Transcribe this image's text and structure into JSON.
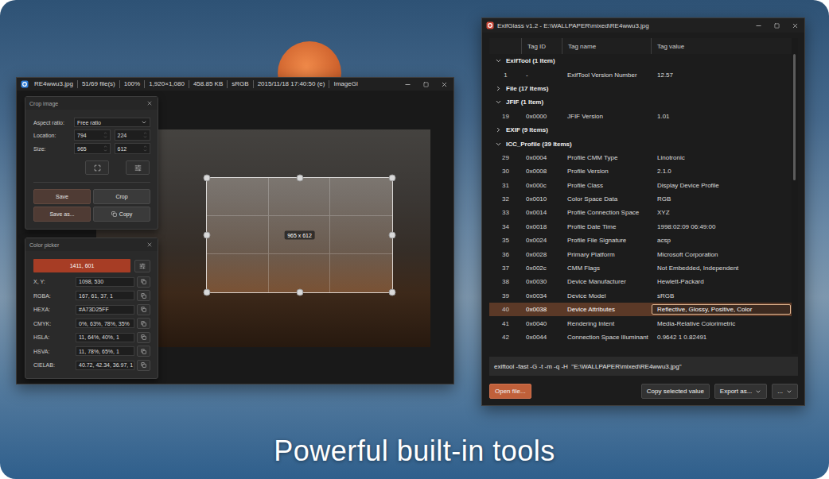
{
  "caption": "Powerful built-in tools",
  "viewer": {
    "title_fields": [
      "RE4wwu3.jpg",
      "51/69 file(s)",
      "100%",
      "1,920×1,080",
      "458.85 KB",
      "sRGB",
      "2015/11/18 17:40:50 (e)",
      "ImageGl"
    ],
    "crop_label": "965 x 612",
    "crop_panel": {
      "title": "Crop image",
      "aspect": {
        "label": "Aspect ratio:",
        "value": "Free ratio"
      },
      "location": {
        "label": "Location:",
        "values": [
          "794",
          "224"
        ]
      },
      "size": {
        "label": "Size:",
        "values": [
          "965",
          "612"
        ]
      },
      "buttons": [
        {
          "label": "Save",
          "accent": true,
          "with_icon": false
        },
        {
          "label": "Crop",
          "accent": false,
          "with_icon": false
        },
        {
          "label": "Save as...",
          "accent": true,
          "with_icon": false
        },
        {
          "label": "Copy",
          "accent": false,
          "with_icon": true
        }
      ]
    },
    "color_panel": {
      "title": "Color picker",
      "swatch": {
        "value": "1411, 601",
        "color": "#A73D25"
      },
      "rows": [
        {
          "label": "X, Y:",
          "value": "1098, 530"
        },
        {
          "label": "RGBA:",
          "value": "167, 61, 37, 1"
        },
        {
          "label": "HEXA:",
          "value": "#A73D25FF"
        },
        {
          "label": "CMYK:",
          "value": "0%, 63%, 78%, 35%"
        },
        {
          "label": "HSLA:",
          "value": "11, 64%, 40%, 1"
        },
        {
          "label": "HSVA:",
          "value": "11, 78%, 65%, 1"
        },
        {
          "label": "CIELAB:",
          "value": "40.72, 42.34, 36.97, 1"
        }
      ]
    }
  },
  "exif": {
    "title": "ExifGlass v1.2 - E:\\WALLPAPER\\mixed\\RE4wwu3.jpg",
    "columns": [
      "Tag ID",
      "Tag name",
      "Tag value"
    ],
    "groups": [
      {
        "label": "ExifTool (1 Item)",
        "expanded": true,
        "rows": [
          {
            "index": "1",
            "tag_id": "-",
            "name": "ExifTool Version Number",
            "value": "12.57",
            "selected": false
          }
        ]
      },
      {
        "label": "File (17 Items)",
        "expanded": false,
        "rows": []
      },
      {
        "label": "JFIF (1 Item)",
        "expanded": true,
        "rows": [
          {
            "index": "19",
            "tag_id": "0x0000",
            "name": "JFIF Version",
            "value": "1.01",
            "selected": false
          }
        ]
      },
      {
        "label": "EXIF (9 Items)",
        "expanded": false,
        "rows": []
      },
      {
        "label": "ICC_Profile (39 Items)",
        "expanded": true,
        "rows": [
          {
            "index": "29",
            "tag_id": "0x0004",
            "name": "Profile CMM Type",
            "value": "Linotronic",
            "selected": false
          },
          {
            "index": "30",
            "tag_id": "0x0008",
            "name": "Profile Version",
            "value": "2.1.0",
            "selected": false
          },
          {
            "index": "31",
            "tag_id": "0x000c",
            "name": "Profile Class",
            "value": "Display Device Profile",
            "selected": false
          },
          {
            "index": "32",
            "tag_id": "0x0010",
            "name": "Color Space Data",
            "value": "RGB",
            "selected": false
          },
          {
            "index": "33",
            "tag_id": "0x0014",
            "name": "Profile Connection Space",
            "value": "XYZ",
            "selected": false
          },
          {
            "index": "34",
            "tag_id": "0x0018",
            "name": "Profile Date Time",
            "value": "1998:02:09 06:49:00",
            "selected": false
          },
          {
            "index": "35",
            "tag_id": "0x0024",
            "name": "Profile File Signature",
            "value": "acsp",
            "selected": false
          },
          {
            "index": "36",
            "tag_id": "0x0028",
            "name": "Primary Platform",
            "value": "Microsoft Corporation",
            "selected": false
          },
          {
            "index": "37",
            "tag_id": "0x002c",
            "name": "CMM Flags",
            "value": "Not Embedded, Independent",
            "selected": false
          },
          {
            "index": "38",
            "tag_id": "0x0030",
            "name": "Device Manufacturer",
            "value": "Hewlett-Packard",
            "selected": false
          },
          {
            "index": "39",
            "tag_id": "0x0034",
            "name": "Device Model",
            "value": "sRGB",
            "selected": false
          },
          {
            "index": "40",
            "tag_id": "0x0038",
            "name": "Device Attributes",
            "value": "Reflective, Glossy, Positive, Color",
            "selected": true
          },
          {
            "index": "41",
            "tag_id": "0x0040",
            "name": "Rendering Intent",
            "value": "Media-Relative Colorimetric",
            "selected": false
          },
          {
            "index": "42",
            "tag_id": "0x0044",
            "name": "Connection Space Illuminant",
            "value": "0.9642 1 0.82491",
            "selected": false
          }
        ]
      }
    ],
    "scrollbar": {
      "level": 0.42
    },
    "command": "exiftool -fast -G -t -m -q -H  \"E:\\WALLPAPER\\mixed\\RE4wwu3.jpg\"",
    "buttons": [
      {
        "label": "Open file...",
        "accent": true,
        "dropdown": false
      },
      {
        "label": "Copy selected value",
        "accent": false,
        "dropdown": false
      },
      {
        "label": "Export as...",
        "accent": false,
        "dropdown": true
      },
      {
        "label": "...",
        "accent": false,
        "dropdown": true
      }
    ]
  }
}
